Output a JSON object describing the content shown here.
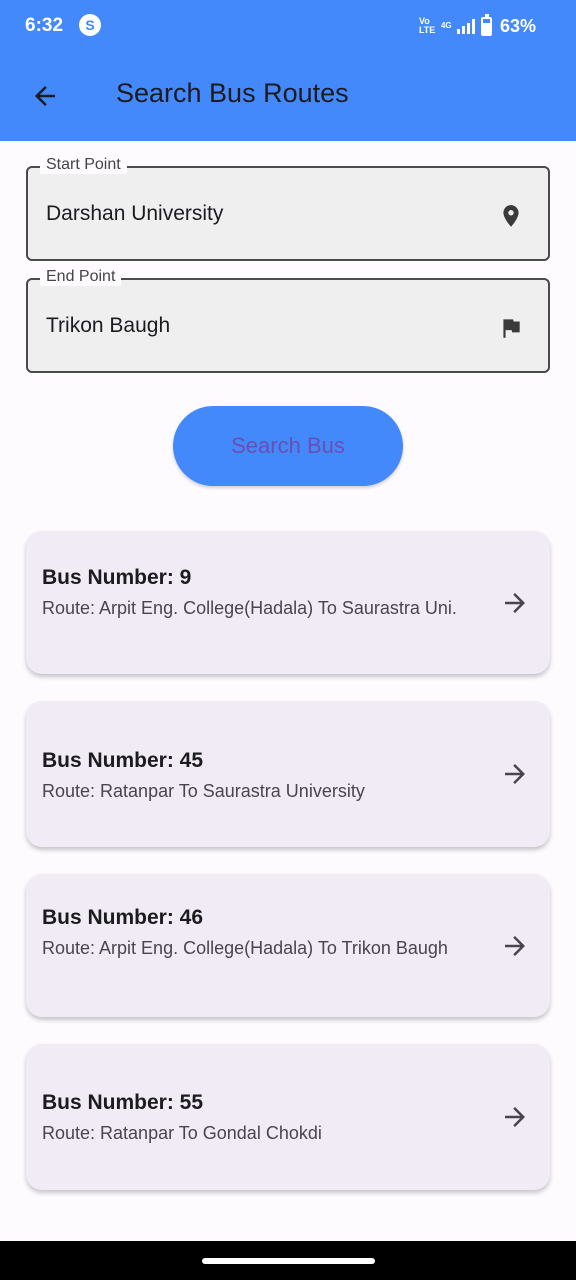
{
  "status_bar": {
    "time": "6:32",
    "app_icon_glyph": "S",
    "volte_label": "Vo LTE",
    "network_label": "4G",
    "battery_percent": "63%"
  },
  "app_bar": {
    "title": "Search Bus Routes",
    "back_icon": "arrow-back-icon",
    "background_color": "#4489fb"
  },
  "form": {
    "start_point": {
      "label": "Start Point",
      "value": "Darshan University",
      "icon": "location-pin-icon"
    },
    "end_point": {
      "label": "End Point",
      "value": "Trikon Baugh",
      "icon": "flag-icon"
    },
    "search_button_label": "Search Bus"
  },
  "results": [
    {
      "title": "Bus Number: 9",
      "route": "Route: Arpit Eng. College(Hadala) To Saurastra Uni."
    },
    {
      "title": "Bus Number: 45",
      "route": "Route: Ratanpar To Saurastra University"
    },
    {
      "title": "Bus Number: 46",
      "route": "Route: Arpit Eng. College(Hadala) To Trikon Baugh"
    },
    {
      "title": "Bus Number: 55",
      "route": "Route: Ratanpar To Gondal Chokdi"
    }
  ],
  "colors": {
    "accent": "#4489fb",
    "card_background": "#f1ebf5",
    "button_text": "#6a4fb0"
  }
}
